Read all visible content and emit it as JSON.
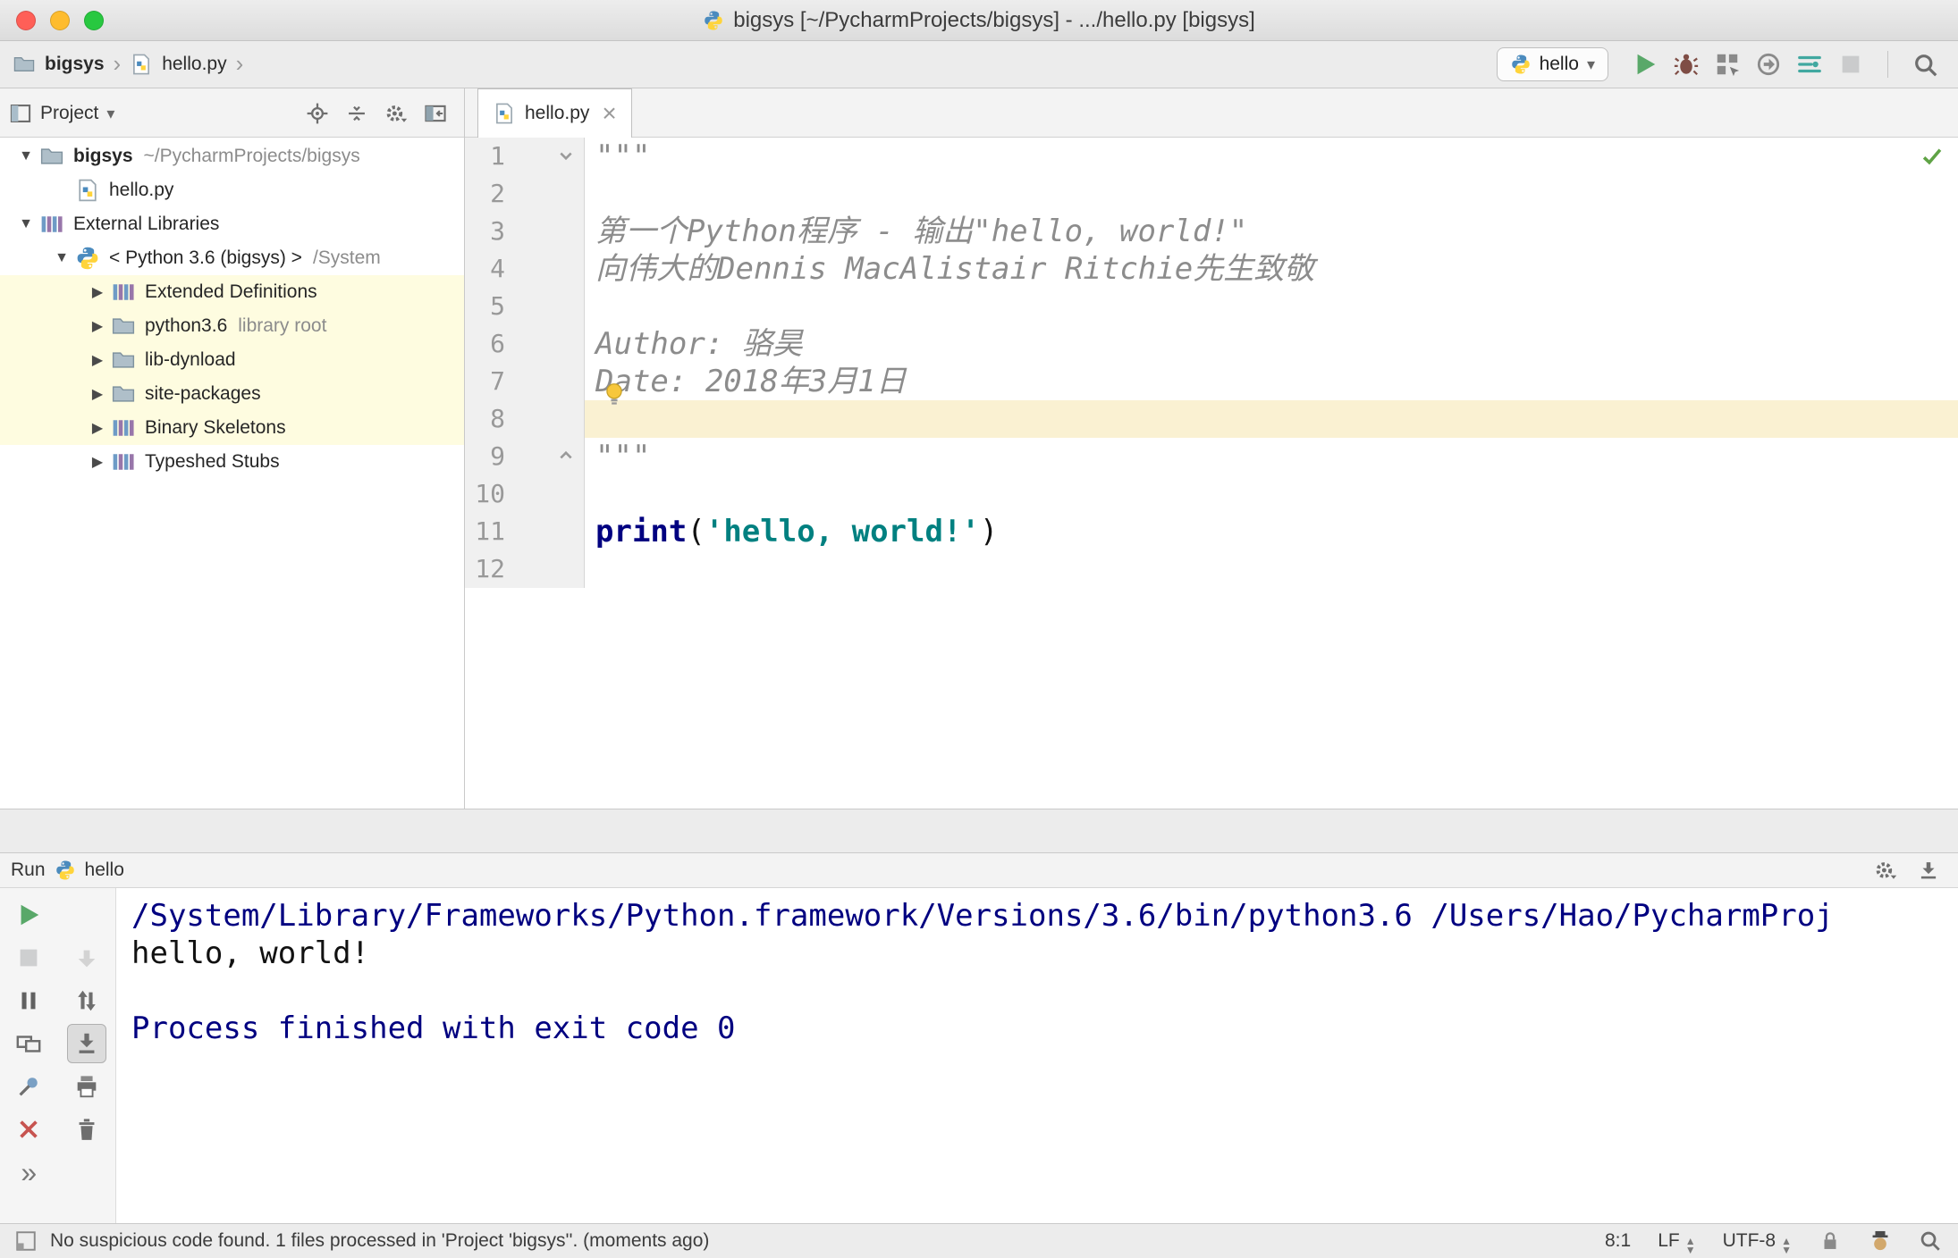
{
  "window": {
    "title": "bigsys [~/PycharmProjects/bigsys] - .../hello.py [bigsys]"
  },
  "icon_glyphs": {
    "breadcrumb-separator": "›",
    "chevron-down": "▾",
    "tree-expanded": "▼",
    "tree-collapsed": "▶",
    "close": "×",
    "more": "»"
  },
  "toolbar": {
    "breadcrumbs": [
      {
        "label": "bigsys",
        "icon": "folder"
      },
      {
        "label": "hello.py",
        "icon": "python-file"
      }
    ],
    "run_config": "hello",
    "actions": [
      {
        "id": "run",
        "icon": "play-green"
      },
      {
        "id": "debug",
        "icon": "bug"
      },
      {
        "id": "run-coverage",
        "icon": "coverage"
      },
      {
        "id": "profiler",
        "icon": "profiler"
      },
      {
        "id": "concurrency-diagram",
        "icon": "concurrency"
      },
      {
        "id": "stop",
        "icon": "stop-grey",
        "disabled": true
      }
    ]
  },
  "project_panel": {
    "title": "Project",
    "header_actions": [
      {
        "id": "locate",
        "icon": "target"
      },
      {
        "id": "collapse-all",
        "icon": "collapse"
      },
      {
        "id": "settings",
        "icon": "settings-chev"
      },
      {
        "id": "hide-panel",
        "icon": "hide-panel"
      }
    ],
    "tree": [
      {
        "label": "bigsys",
        "suffix": "~/PycharmProjects/bigsys",
        "level": 0,
        "arrow": "down",
        "icon": "folder",
        "bold": true
      },
      {
        "label": "hello.py",
        "level": 1,
        "icon": "python-file"
      },
      {
        "label": "External Libraries",
        "level": 0,
        "arrow": "down",
        "icon": "libs"
      },
      {
        "label": "< Python 3.6 (bigsys) >",
        "suffix": "/System",
        "level": 1,
        "arrow": "down",
        "icon": "python"
      },
      {
        "label": "Extended Definitions",
        "level": 2,
        "arrow": "right",
        "icon": "libs",
        "highlight": true
      },
      {
        "label": "python3.6",
        "suffix": "library root",
        "level": 2,
        "arrow": "right",
        "icon": "folder",
        "highlight": true
      },
      {
        "label": "lib-dynload",
        "level": 2,
        "arrow": "right",
        "icon": "folder",
        "highlight": true
      },
      {
        "label": "site-packages",
        "level": 2,
        "arrow": "right",
        "icon": "folder",
        "highlight": true
      },
      {
        "label": "Binary Skeletons",
        "level": 2,
        "arrow": "right",
        "icon": "libs",
        "highlight": true
      },
      {
        "label": "Typeshed Stubs",
        "level": 2,
        "arrow": "right",
        "icon": "libs"
      }
    ]
  },
  "editor": {
    "tabs": [
      {
        "label": "hello.py",
        "active": true
      }
    ],
    "current_line": 8,
    "lines": [
      {
        "num": 1,
        "segments": [
          {
            "text": "\"\"\"",
            "style": "doc"
          }
        ]
      },
      {
        "num": 2,
        "segments": []
      },
      {
        "num": 3,
        "segments": [
          {
            "text": "第一个Python程序 - 输出\"hello, world!\"",
            "style": "doc"
          }
        ]
      },
      {
        "num": 4,
        "segments": [
          {
            "text": "向伟大的Dennis MacAlistair Ritchie先生致敬",
            "style": "doc"
          }
        ]
      },
      {
        "num": 5,
        "segments": []
      },
      {
        "num": 6,
        "segments": [
          {
            "text": "Author: 骆昊",
            "style": "doc"
          }
        ]
      },
      {
        "num": 7,
        "segments": [
          {
            "text": "Date: 2018年3月1日",
            "style": "doc"
          }
        ]
      },
      {
        "num": 8,
        "segments": []
      },
      {
        "num": 9,
        "segments": [
          {
            "text": "\"\"\"",
            "style": "doc"
          }
        ]
      },
      {
        "num": 10,
        "segments": []
      },
      {
        "num": 11,
        "segments": [
          {
            "text": "print",
            "style": "kw"
          },
          {
            "text": "(",
            "style": "plain"
          },
          {
            "text": "'hello, world!'",
            "style": "str"
          },
          {
            "text": ")",
            "style": "plain"
          }
        ]
      },
      {
        "num": 12,
        "segments": []
      }
    ]
  },
  "run_panel": {
    "title": "Run",
    "config": "hello",
    "header_actions": [
      {
        "id": "run-settings",
        "icon": "settings-chev"
      },
      {
        "id": "hide-window",
        "icon": "dock-down"
      }
    ],
    "toolbar_main": [
      {
        "id": "rerun",
        "icon": "play-green"
      },
      {
        "id": "stop",
        "icon": "stop-grey",
        "disabled": true
      },
      {
        "id": "pause-output",
        "icon": "pause"
      },
      {
        "id": "restore-layout",
        "icon": "monitor"
      },
      {
        "id": "pin-tab",
        "icon": "pin"
      },
      {
        "id": "close",
        "icon": "close-red"
      },
      {
        "id": "more",
        "icon": "more"
      }
    ],
    "toolbar_console": [
      {
        "id": "scroll-down",
        "icon": "arrow-down-grey",
        "disabled": true
      },
      {
        "id": "swap-output",
        "icon": "swap"
      },
      {
        "id": "scroll-to-end",
        "icon": "scroll-end",
        "selected": true
      },
      {
        "id": "print",
        "icon": "printer"
      },
      {
        "id": "clear-all",
        "icon": "trash"
      }
    ],
    "console": [
      {
        "text": "/System/Library/Frameworks/Python.framework/Versions/3.6/bin/python3.6 /Users/Hao/PycharmProj",
        "style": "system"
      },
      {
        "text": "hello, world!",
        "style": "stdout"
      },
      {
        "text": "",
        "style": "stdout"
      },
      {
        "text": "Process finished with exit code 0",
        "style": "system"
      }
    ]
  },
  "status_bar": {
    "message": "No suspicious code found. 1 files processed in 'Project 'bigsys''. (moments ago)",
    "caret": "8:1",
    "line_separator": "LF",
    "encoding": "UTF-8"
  },
  "colors": {
    "run_green": "#59A869",
    "close_red": "#C75450",
    "tree_highlight": "#FEFCE0",
    "current_line": "#FAF1D2",
    "docstring": "#8C8C8C",
    "keyword": "#000080",
    "string": "#008080",
    "console_system": "#000080"
  }
}
